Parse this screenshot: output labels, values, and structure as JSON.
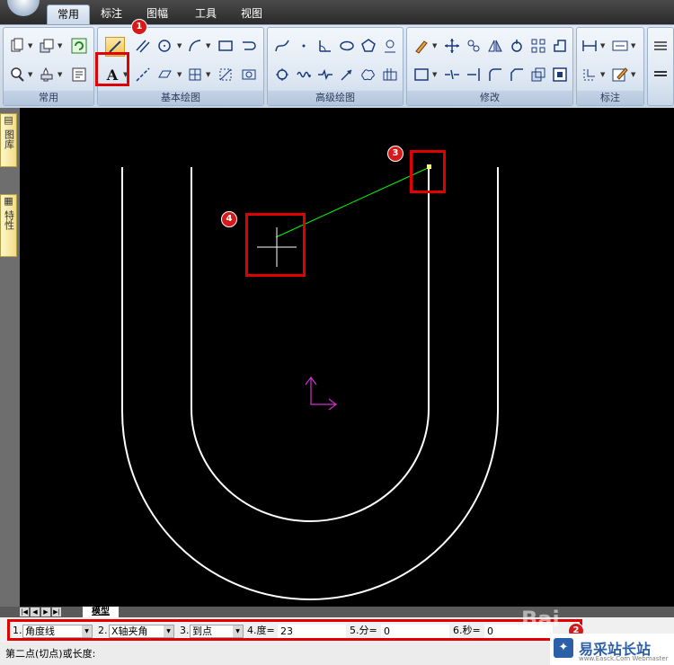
{
  "tabs": [
    "常用",
    "标注",
    "图幅",
    "工具",
    "视图"
  ],
  "ribbon": {
    "groups": [
      "常用",
      "基本绘图",
      "高级绘图",
      "修改",
      "标注"
    ]
  },
  "sidebar": {
    "tabs": [
      "图库",
      "特性"
    ]
  },
  "canvas": {
    "colors": {
      "shape": "#ffffff",
      "line": "#00ff00",
      "axis": "#cc33cc",
      "highlight": "#e00000"
    }
  },
  "annotations": [
    "1",
    "2",
    "3",
    "4"
  ],
  "sheet_tab": "模型",
  "command": {
    "item1_num": "1.",
    "item1_value": "角度线",
    "item2_num": "2.",
    "item2_value": "X轴夹角",
    "item3_num": "3.",
    "item3_value": "到点",
    "deg_label": "4.度=",
    "deg_value": "23",
    "min_label": "5.分=",
    "min_value": "0",
    "sec_label": "6.秒=",
    "sec_value": "0"
  },
  "status": "第二点(切点)或长度:",
  "watermark": {
    "baidu": "Bai",
    "site_name": "易采站长站",
    "site_url": "www.Easck.Com Webmaster"
  }
}
